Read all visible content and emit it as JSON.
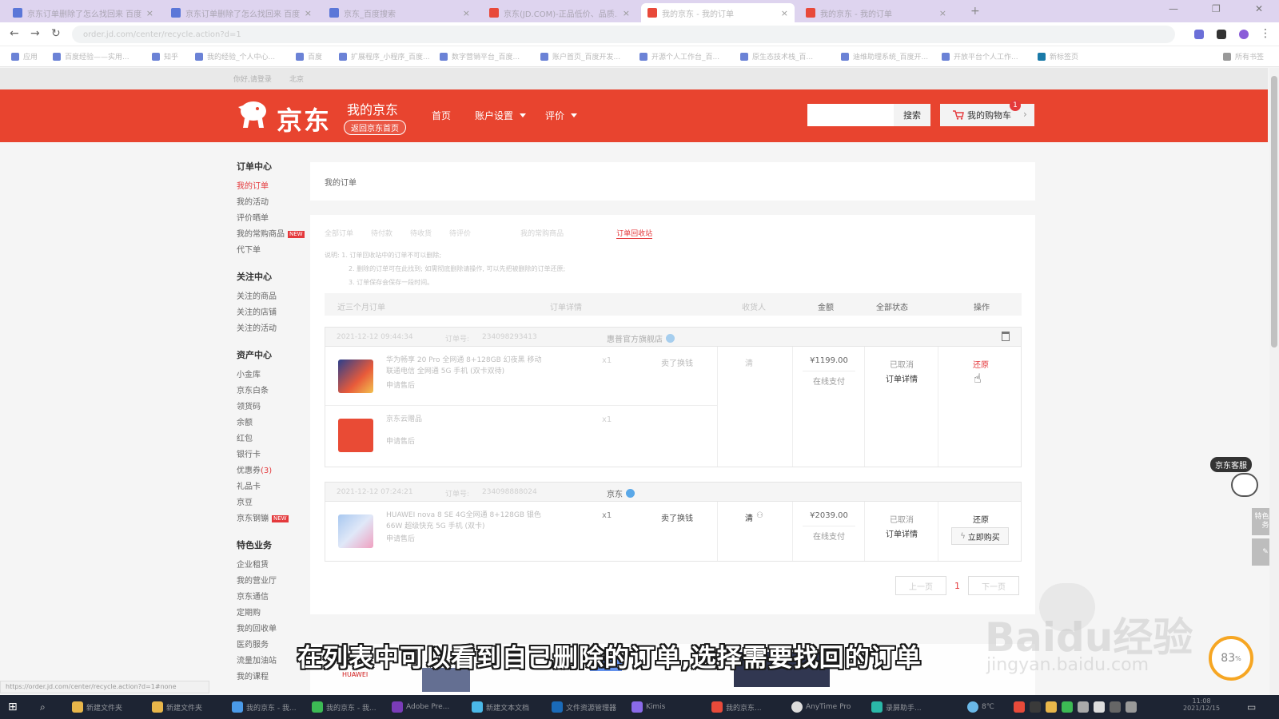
{
  "browser": {
    "tabs": [
      {
        "label": "京东订单删除了怎么找回来 百度...",
        "active": false
      },
      {
        "label": "京东订单删除了怎么找回来 百度...",
        "active": false
      },
      {
        "label": "京东_百度搜索",
        "active": false
      },
      {
        "label": "京东(JD.COM)-正品低价、品质...",
        "active": false
      },
      {
        "label": "我的京东 - 我的订单",
        "active": true
      },
      {
        "label": "我的京东 - 我的订单",
        "active": false
      }
    ],
    "url": "order.jd.com/center/recycle.action?d=1",
    "bookmarks": [
      "应用",
      "百度经验——实用...",
      "知乎",
      "我的经验_个人中心...",
      "百度",
      "扩展程序_小程序_百度...",
      "数字营销平台_百度...",
      "账户首页_百度开发...",
      "开源个人工作台_百...",
      "原生态技术栈_百...",
      "迪维助理系统_百度开...",
      "开放平台个人工作...",
      "新标签页"
    ],
    "all_bookmarks": "所有书签"
  },
  "jd_topbar": [
    "你好,请登录",
    "北京"
  ],
  "header": {
    "logo_text": "京东",
    "my_jd": "我的京东",
    "back_home": "返回京东首页",
    "nav": [
      {
        "label": "首页",
        "dropdown": false
      },
      {
        "label": "账户设置",
        "dropdown": true
      },
      {
        "label": "评价",
        "dropdown": true
      }
    ],
    "search_button": "搜索",
    "cart_label": "我的购物车",
    "cart_count": "1"
  },
  "sidebar": {
    "groups": [
      {
        "title": "订单中心",
        "items": [
          {
            "label": "我的订单",
            "active": true
          },
          {
            "label": "我的活动"
          },
          {
            "label": "评价晒单"
          },
          {
            "label": "我的常购商品",
            "new": true
          },
          {
            "label": "代下单"
          }
        ]
      },
      {
        "title": "关注中心",
        "items": [
          {
            "label": "关注的商品"
          },
          {
            "label": "关注的店铺"
          },
          {
            "label": "关注的活动"
          }
        ]
      },
      {
        "title": "资产中心",
        "items": [
          {
            "label": "小金库"
          },
          {
            "label": "京东白条"
          },
          {
            "label": "领货码"
          },
          {
            "label": "余额"
          },
          {
            "label": "红包"
          },
          {
            "label": "银行卡"
          },
          {
            "label": "优惠券",
            "count": "(3)"
          },
          {
            "label": "礼品卡"
          },
          {
            "label": "京豆"
          },
          {
            "label": "京东钢镚",
            "new": true
          }
        ]
      },
      {
        "title": "特色业务",
        "items": [
          {
            "label": "企业租赁"
          },
          {
            "label": "我的营业厅"
          },
          {
            "label": "京东通信"
          },
          {
            "label": "定期购"
          },
          {
            "label": "我的回收单"
          },
          {
            "label": "医药服务"
          },
          {
            "label": "流量加油站"
          },
          {
            "label": "我的课程"
          }
        ]
      }
    ],
    "new_tag": "NEW"
  },
  "main": {
    "breadcrumb": "我的订单",
    "order_tabs": [
      {
        "label": "全部订单"
      },
      {
        "label": "待付款"
      },
      {
        "label": "待收货"
      },
      {
        "label": "待评价"
      },
      {
        "label": "我的常购商品"
      },
      {
        "label": "订单回收站",
        "selected": true
      }
    ],
    "notes": [
      "说明: 1. 订单回收站中的订单不可以删除;",
      "2. 删除的订单可在此找到; 如需彻底删除请操作, 可以先把被删除的订单还原;",
      "3. 订单保存会保存一段时间。"
    ],
    "table_headers": {
      "range": "近三个月订单",
      "details": "订单详情",
      "consignee": "收货人",
      "amount": "金额",
      "status": "全部状态",
      "action": "操作"
    },
    "orders": [
      {
        "time": "2021-12-12 09:44:34",
        "order_no_label": "订单号:",
        "order_no": "234098293413",
        "shop": "惠普官方旗舰店",
        "products": [
          {
            "title": "华为畅享 20 Pro 全网通 8+128GB 幻夜黑 移动联通电信 全网通 5G 手机 (双卡双待)",
            "qty": "x1",
            "action": "卖了换钱",
            "service": "申请售后"
          },
          {
            "title": "京东云赠品",
            "qty": "x1",
            "action": "",
            "service": "申请售后"
          }
        ],
        "consignee": "清",
        "price": "¥1199.00",
        "payment": "在线支付",
        "status": "已取消",
        "detail_link": "订单详情",
        "op": "还原",
        "op_red": true
      },
      {
        "time": "2021-12-12 07:24:21",
        "order_no_label": "订单号:",
        "order_no": "234098888024",
        "shop": "京东",
        "products": [
          {
            "title": "HUAWEI nova 8 SE 4G全网通 8+128GB 银色 66W 超级快充 5G 手机 (双卡)",
            "qty": "x1",
            "action": "卖了换钱",
            "service": "申请售后"
          }
        ],
        "consignee": "清",
        "price": "¥2039.00",
        "payment": "在线支付",
        "status": "已取消",
        "detail_link": "订单详情",
        "op": "还原",
        "buy_again": "立即购买"
      }
    ],
    "pager": {
      "prev": "上一页",
      "current": "1",
      "next": "下一页"
    }
  },
  "float": {
    "customer_service": "京东客服",
    "feature_service": "特色服务",
    "progress": "83",
    "progress_unit": "%"
  },
  "overlay": {
    "subtitle": "在列表中可以看到自己删除的订单,选择需要找回的订单",
    "watermark_main": "Baidu经验",
    "watermark_sub": "jingyan.baidu.com"
  },
  "status_url": "https://order.jd.com/center/recycle.action?d=1#none",
  "bottom_brand": "HUAWEI",
  "taskbar": {
    "items": [
      "新建文件夹",
      "新建文件夹",
      "我的京东 - 我...",
      "我的京东 - 我...",
      "Adobe Pre...",
      "新建文本文档",
      "文件资源管理器",
      "Kimis",
      "我的京东...",
      "AnyTime Pro",
      "录屏助手..."
    ],
    "weather": "8℃",
    "time": "11:08",
    "date": "2021/12/15"
  }
}
